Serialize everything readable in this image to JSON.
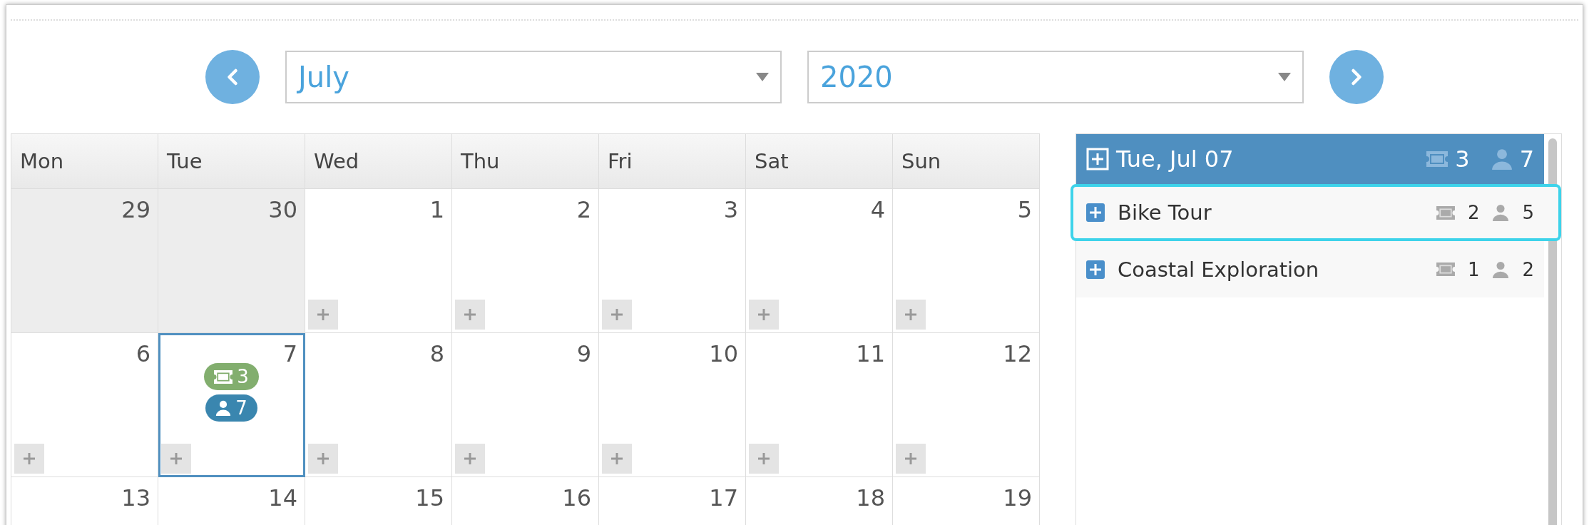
{
  "navigation": {
    "month": "July",
    "year": "2020"
  },
  "calendar": {
    "weekdays": [
      "Mon",
      "Tue",
      "Wed",
      "Thu",
      "Fri",
      "Sat",
      "Sun"
    ],
    "weeks": [
      [
        {
          "day": "29",
          "past": true,
          "add_button": false,
          "selected": false
        },
        {
          "day": "30",
          "past": true,
          "add_button": false,
          "selected": false
        },
        {
          "day": "1",
          "past": false,
          "add_button": true,
          "selected": false
        },
        {
          "day": "2",
          "past": false,
          "add_button": true,
          "selected": false
        },
        {
          "day": "3",
          "past": false,
          "add_button": true,
          "selected": false
        },
        {
          "day": "4",
          "past": false,
          "add_button": true,
          "selected": false
        },
        {
          "day": "5",
          "past": false,
          "add_button": true,
          "selected": false
        }
      ],
      [
        {
          "day": "6",
          "past": false,
          "add_button": true,
          "selected": false
        },
        {
          "day": "7",
          "past": false,
          "add_button": true,
          "selected": true,
          "tickets": "3",
          "people": "7"
        },
        {
          "day": "8",
          "past": false,
          "add_button": true,
          "selected": false
        },
        {
          "day": "9",
          "past": false,
          "add_button": true,
          "selected": false
        },
        {
          "day": "10",
          "past": false,
          "add_button": true,
          "selected": false
        },
        {
          "day": "11",
          "past": false,
          "add_button": true,
          "selected": false
        },
        {
          "day": "12",
          "past": false,
          "add_button": true,
          "selected": false
        }
      ],
      [
        {
          "day": "13",
          "past": false,
          "add_button": false,
          "selected": false
        },
        {
          "day": "14",
          "past": false,
          "add_button": false,
          "selected": false
        },
        {
          "day": "15",
          "past": false,
          "add_button": false,
          "selected": false
        },
        {
          "day": "16",
          "past": false,
          "add_button": false,
          "selected": false
        },
        {
          "day": "17",
          "past": false,
          "add_button": false,
          "selected": false
        },
        {
          "day": "18",
          "past": false,
          "add_button": false,
          "selected": false
        },
        {
          "day": "19",
          "past": false,
          "add_button": false,
          "selected": false
        }
      ]
    ]
  },
  "day_panel": {
    "title": "Tue, Jul 07",
    "tickets": "3",
    "people": "7",
    "items": [
      {
        "name": "Bike Tour",
        "tickets": "2",
        "people": "5",
        "highlighted": true
      },
      {
        "name": "Coastal Exploration",
        "tickets": "1",
        "people": "2",
        "highlighted": false
      }
    ]
  }
}
